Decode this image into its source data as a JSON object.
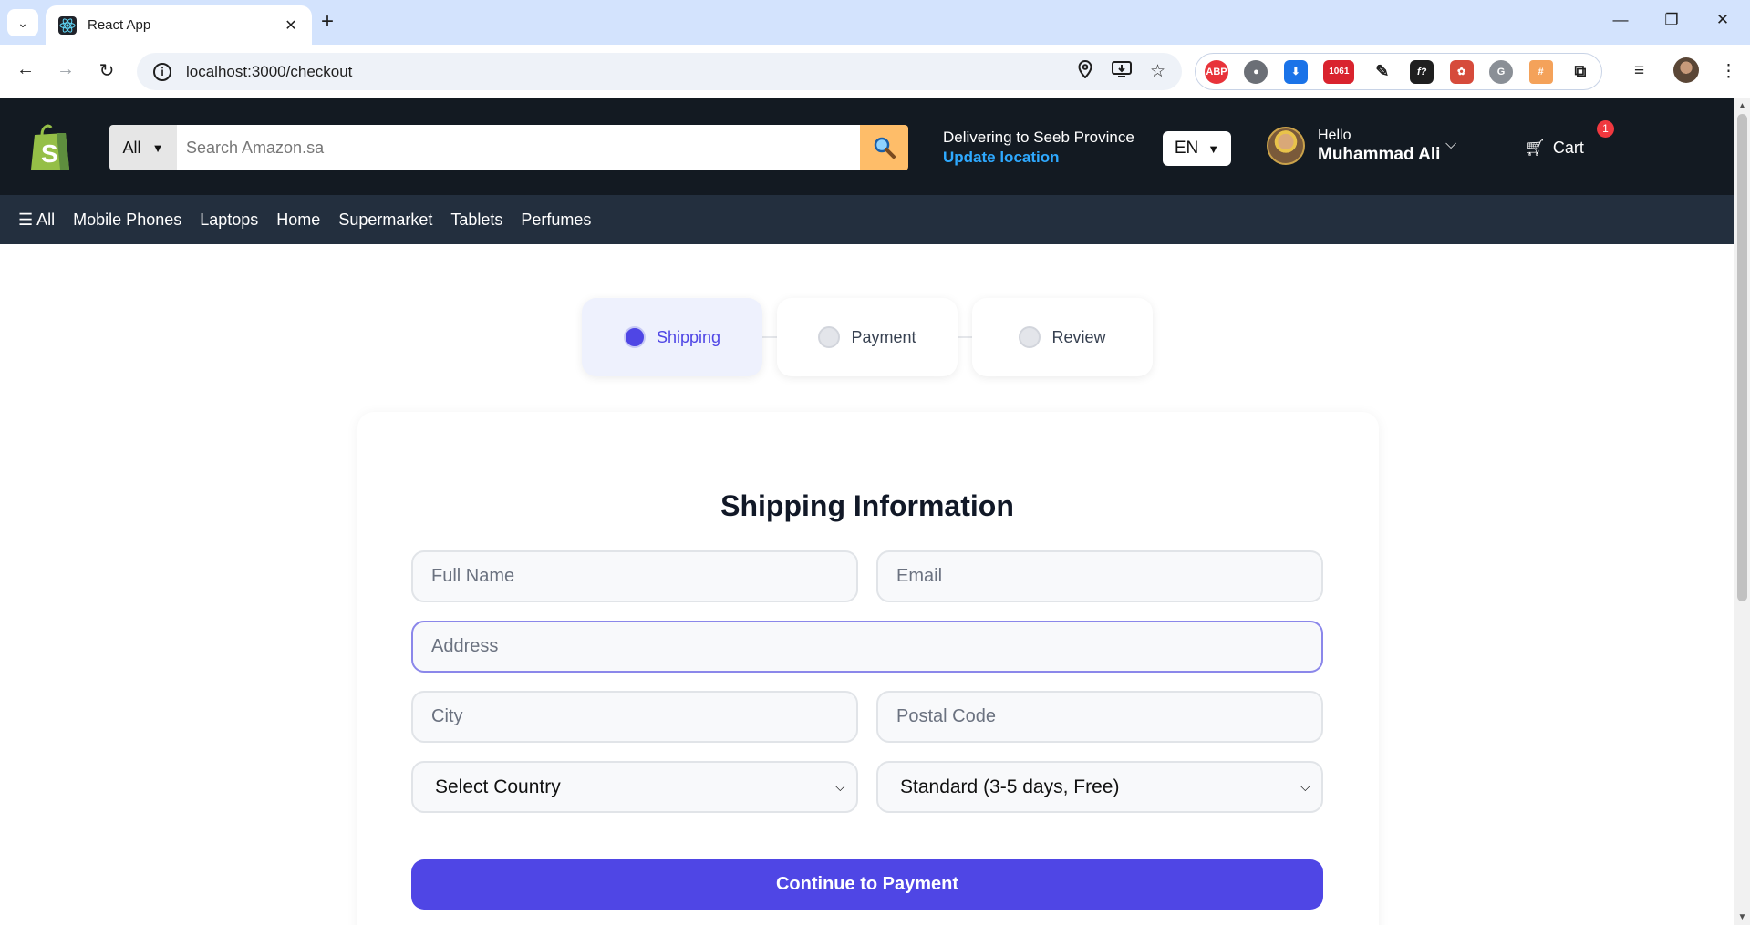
{
  "browser": {
    "tab_title": "React App",
    "url": "localhost:3000/checkout",
    "extensions": {
      "abp_label": "ABP",
      "badge_count": "1061"
    }
  },
  "header": {
    "search": {
      "category": "All",
      "placeholder": "Search Amazon.sa"
    },
    "delivery": {
      "line1": "Delivering to Seeb Province",
      "line2": "Update location"
    },
    "language": "EN",
    "user": {
      "greeting": "Hello",
      "name": "Muhammad Ali"
    },
    "cart": {
      "label": "Cart",
      "count": "1"
    },
    "colors": {
      "header_bg": "#131a22",
      "subnav_bg": "#232f3e",
      "search_button": "#febd69",
      "link": "#2ea9ff"
    }
  },
  "subnav": {
    "items": [
      "☰ All",
      "Mobile Phones",
      "Laptops",
      "Home",
      "Supermarket",
      "Tablets",
      "Perfumes"
    ]
  },
  "stepper": {
    "steps": [
      {
        "label": "Shipping",
        "active": true
      },
      {
        "label": "Payment",
        "active": false
      },
      {
        "label": "Review",
        "active": false
      }
    ],
    "accent": "#4f46e5"
  },
  "form": {
    "title": "Shipping Information",
    "full_name_placeholder": "Full Name",
    "email_placeholder": "Email",
    "address_placeholder": "Address",
    "city_placeholder": "City",
    "postal_placeholder": "Postal Code",
    "country_selected": "Select Country",
    "shipping_selected": "Standard (3-5 days, Free)",
    "submit_label": "Continue to Payment"
  },
  "icons": {
    "favicon": "react-icon",
    "search": "magnifier-icon",
    "cart": "cart-icon",
    "logo": "shopify-bag-icon"
  }
}
